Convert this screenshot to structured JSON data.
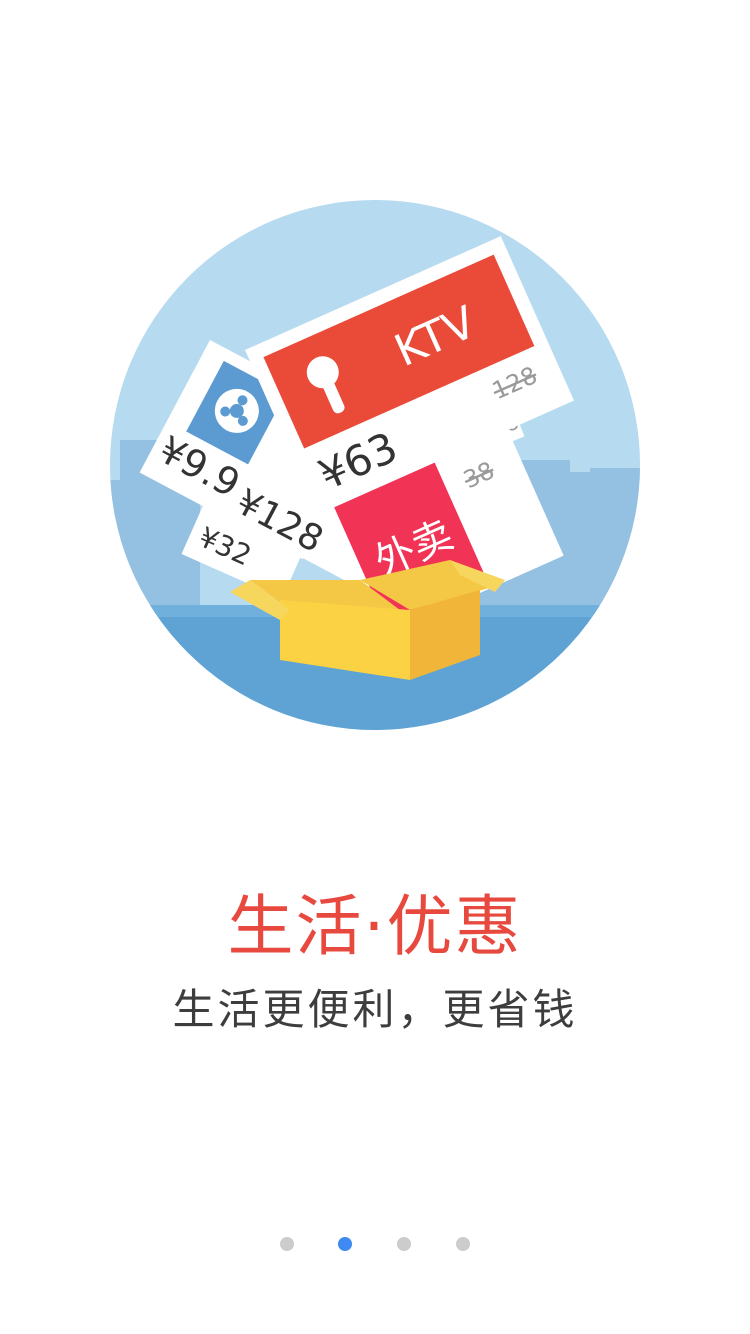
{
  "colors": {
    "headline": "#e8493f",
    "subline": "#3d3d3d",
    "dot_active": "#3f8af2",
    "dot_inactive": "#cccccc"
  },
  "illustration": {
    "ktv_label": "KTV",
    "ktv_price": "¥63",
    "ktv_original_price": "128",
    "movie_price": "¥9.99",
    "ticket_price_2": "¥128",
    "ticket_price_3": "¥32",
    "takeout_label": "外卖",
    "takeout_original_price": "38",
    "small_original_price": "38"
  },
  "headline": {
    "title": "生活·优惠",
    "subtitle": "生活更便利，更省钱"
  },
  "pager": {
    "current_index": 1,
    "total": 4
  }
}
